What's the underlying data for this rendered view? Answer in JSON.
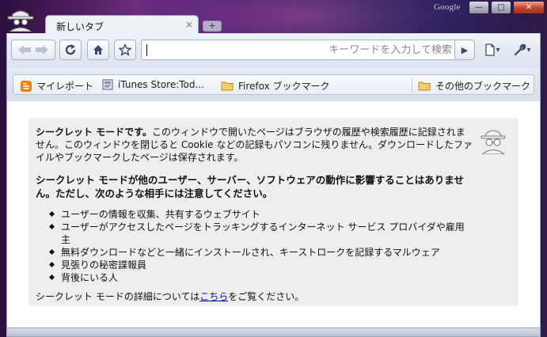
{
  "window": {
    "watermark": "Google",
    "controls": {
      "minimize": "—",
      "maximize": "□",
      "close": "✕"
    }
  },
  "tab": {
    "title": "新しいタブ",
    "close": "×",
    "new_tab": "+"
  },
  "toolbar": {
    "search_placeholder": "キーワードを入力して検索",
    "go_icon": "▶",
    "page_menu": "▾",
    "tools_menu": "▾"
  },
  "bookmarks": {
    "items": [
      {
        "label": "マイレポート",
        "icon": "blogger-icon"
      },
      {
        "label": "iTunes Store:Tod...",
        "icon": "page-icon"
      },
      {
        "label": "Firefox ブックマーク",
        "icon": "folder-icon"
      }
    ],
    "other": "その他のブックマーク"
  },
  "incognito": {
    "p1_bold": "シークレット モードです。",
    "p1_rest": "このウィンドウで開いたページはブラウザの履歴や検索履歴に記録されません。このウィンドウを閉じると Cookie などの記録もパソコンに残りません。ダウンロードしたファイルやブックマークしたページは保存されます。",
    "p2": "シークレット モードが他のユーザー、サーバー、ソフトウェアの動作に影響することはありません。ただし、次のような相手には注意してください。",
    "list": [
      "ユーザーの情報を収集、共有するウェブサイト",
      "ユーザーがアクセスしたページをトラッキングするインターネット サービス プロバイダや雇用主",
      "無料ダウンロードなどと一緒にインストールされ、キーストロークを記録するマルウェア",
      "見張りの秘密諜報員",
      "背後にいる人"
    ],
    "p3_before": "シークレット モードの詳細については",
    "p3_link": "こちら",
    "p3_after": "をご覧ください。"
  },
  "colors": {
    "link": "#0000cc",
    "blogger": "#f57d00",
    "folder": "#e8b84a"
  }
}
